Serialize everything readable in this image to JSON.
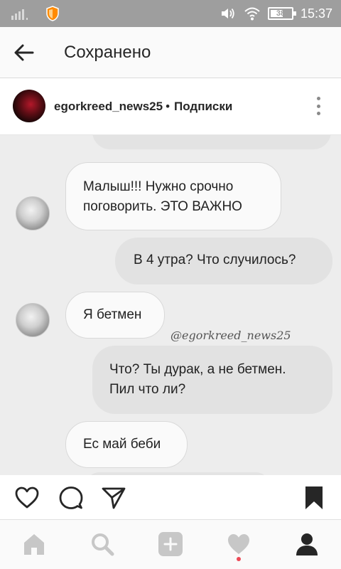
{
  "status_bar": {
    "battery": "38",
    "time": "15:37"
  },
  "header": {
    "title": "Сохранено"
  },
  "post": {
    "username": "egorkreed_news25",
    "separator": "•",
    "follow_label": "Подписки"
  },
  "chat": {
    "messages": [
      {
        "direction": "incoming",
        "lines": [
          "Малыш!!! Нужно срочно",
          "поговорить. ЭТО ВАЖНО"
        ]
      },
      {
        "direction": "outgoing",
        "lines": [
          "В 4 утра? Что случилось?"
        ]
      },
      {
        "direction": "incoming",
        "lines": [
          "Я бетмен"
        ]
      },
      {
        "direction": "outgoing",
        "lines": [
          "Что? Ты дурак, а не бетмен.",
          "Пил что ли?"
        ]
      },
      {
        "direction": "incoming",
        "lines": [
          "Ес май беби"
        ]
      }
    ],
    "watermark": "@egorkreed_news25"
  },
  "actions": {
    "icons": [
      "heart-outline-icon",
      "comment-icon",
      "share-icon",
      "bookmark-filled-icon"
    ]
  },
  "bottom_nav": {
    "items": [
      "home-icon",
      "search-icon",
      "add-icon",
      "activity-icon",
      "profile-icon"
    ],
    "active": "profile-icon",
    "notification_color": "#ed4956"
  },
  "colors": {
    "status_bar": "#9e9e9e",
    "chat_background": "#ededed",
    "incoming_bubble": "#fafafa",
    "outgoing_bubble": "#e2e2e2"
  }
}
